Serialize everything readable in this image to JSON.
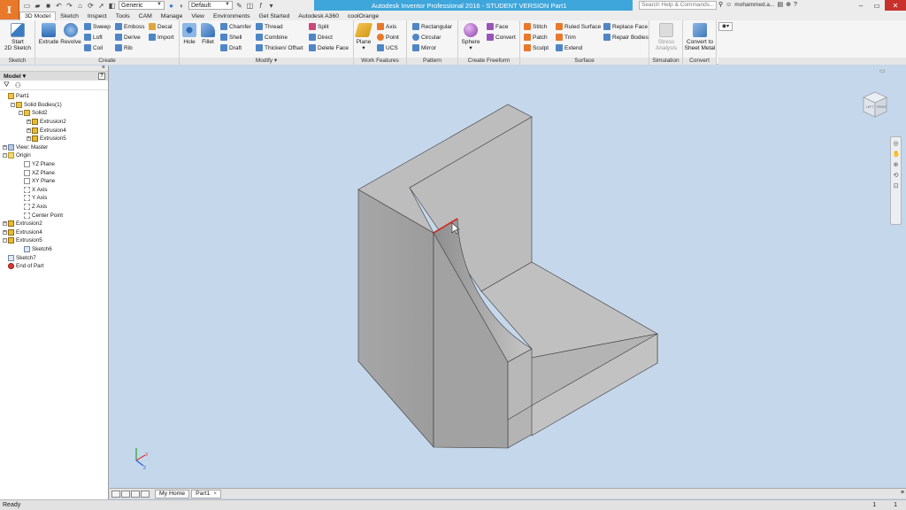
{
  "app": {
    "logo_letter": "I",
    "logo_sub": "PRO",
    "title": "Autodesk Inventor Professional 2016 - STUDENT VERSION    Part1",
    "material_combo": "Generic",
    "appearance_combo": "Default",
    "search_placeholder": "Search Help & Commands...",
    "user": "mohammed.a..."
  },
  "tabs": [
    "3D Model",
    "Sketch",
    "Inspect",
    "Tools",
    "CAM",
    "Manage",
    "View",
    "Environments",
    "Get Started",
    "Autodesk A360",
    "coolOrange"
  ],
  "active_tab": "3D Model",
  "ribbon": {
    "sketch": {
      "label": "Sketch",
      "start": "Start\n2D Sketch"
    },
    "create": {
      "label": "Create",
      "extrude": "Extrude",
      "revolve": "Revolve",
      "sweep": "Sweep",
      "loft": "Loft",
      "coil": "Coil",
      "emboss": "Emboss",
      "derive": "Derive",
      "rib": "Rib",
      "decal": "Decal",
      "import": "Import"
    },
    "modify": {
      "label": "Modify",
      "hole": "Hole",
      "fillet": "Fillet",
      "chamfer": "Chamfer",
      "shell": "Shell",
      "draft": "Draft",
      "thread": "Thread",
      "combine": "Combine",
      "thicken": "Thicken/ Offset",
      "split": "Split",
      "direct": "Direct",
      "delete_face": "Delete Face"
    },
    "work_features": {
      "label": "Work Features",
      "plane": "Plane",
      "axis": "Axis",
      "point": "Point",
      "ucs": "UCS"
    },
    "pattern": {
      "label": "Pattern",
      "rectangular": "Rectangular",
      "circular": "Circular",
      "mirror": "Mirror"
    },
    "freeform": {
      "label": "Create Freeform",
      "sphere": "Sphere",
      "face": "Face",
      "convert": "Convert"
    },
    "surface": {
      "label": "Surface",
      "stitch": "Stitch",
      "patch": "Patch",
      "sculpt": "Sculpt",
      "ruled": "Ruled Surface",
      "trim": "Trim",
      "extend": "Extend",
      "replace": "Replace Face",
      "repair": "Repair Bodies"
    },
    "simulation": {
      "label": "Simulation",
      "stress": "Stress\nAnalysis"
    },
    "convert": {
      "label": "Convert",
      "sheet_metal": "Convert to\nSheet Metal"
    }
  },
  "browser": {
    "title": "Model",
    "help": "?",
    "items": [
      {
        "label": "Part1",
        "level": 0,
        "icon": "part",
        "toggle": ""
      },
      {
        "label": "Solid Bodies(1)",
        "level": 1,
        "icon": "solid",
        "toggle": "-"
      },
      {
        "label": "Solid2",
        "level": 2,
        "icon": "solid",
        "toggle": "-"
      },
      {
        "label": "Extrusion2",
        "level": 3,
        "icon": "ext",
        "toggle": "+"
      },
      {
        "label": "Extrusion4",
        "level": 3,
        "icon": "ext",
        "toggle": "+"
      },
      {
        "label": "Extrusion5",
        "level": 3,
        "icon": "ext",
        "toggle": "+"
      },
      {
        "label": "View: Master",
        "level": 0,
        "icon": "view",
        "toggle": "+"
      },
      {
        "label": "Origin",
        "level": 0,
        "icon": "folder",
        "toggle": "-"
      },
      {
        "label": "YZ Plane",
        "level": 2,
        "icon": "plane",
        "toggle": ""
      },
      {
        "label": "XZ Plane",
        "level": 2,
        "icon": "plane",
        "toggle": ""
      },
      {
        "label": "XY Plane",
        "level": 2,
        "icon": "plane",
        "toggle": ""
      },
      {
        "label": "X Axis",
        "level": 2,
        "icon": "axis",
        "toggle": ""
      },
      {
        "label": "Y Axis",
        "level": 2,
        "icon": "axis",
        "toggle": ""
      },
      {
        "label": "Z Axis",
        "level": 2,
        "icon": "axis",
        "toggle": ""
      },
      {
        "label": "Center Point",
        "level": 2,
        "icon": "axis",
        "toggle": ""
      },
      {
        "label": "Extrusion2",
        "level": 0,
        "icon": "ext",
        "toggle": "+"
      },
      {
        "label": "Extrusion4",
        "level": 0,
        "icon": "ext",
        "toggle": "+"
      },
      {
        "label": "Extrusion5",
        "level": 0,
        "icon": "ext",
        "toggle": "-"
      },
      {
        "label": "Sketch6",
        "level": 2,
        "icon": "sketch",
        "toggle": ""
      },
      {
        "label": "Sketch7",
        "level": 0,
        "icon": "sketch",
        "toggle": ""
      },
      {
        "label": "End of Part",
        "level": 0,
        "icon": "end",
        "toggle": ""
      }
    ]
  },
  "document_tabs": [
    "My Home",
    "Part1"
  ],
  "active_document": "Part1",
  "viewcube": {
    "left": "LEFT",
    "front": "FRONT",
    "top": "TOP"
  },
  "status": {
    "text": "Ready",
    "count1": "1",
    "count2": "1"
  },
  "colors": {
    "accent": "#e8792b",
    "viewport_bg": "#c4d7eb",
    "title_bar": "#46a9dc",
    "model_face": "#bcbcbc",
    "selected_edge": "#d3271f"
  }
}
